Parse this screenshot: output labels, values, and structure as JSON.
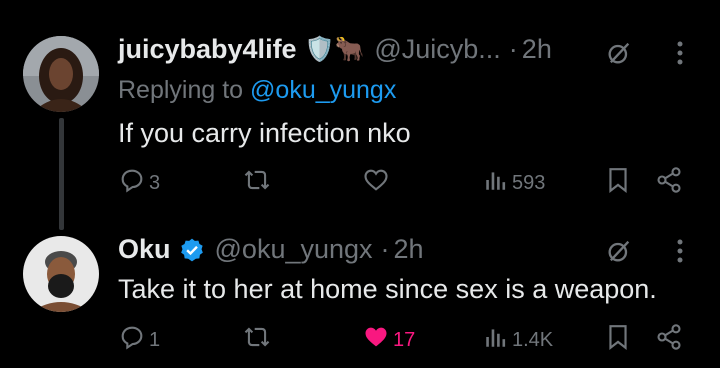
{
  "tweets": [
    {
      "name": "juicybaby4life",
      "badge_emojis": "🛡️🐂",
      "handle": "@Juicyb...",
      "dot": "·",
      "time": "2h",
      "replying_prefix": "Replying to",
      "replying_to": "@oku_yungx",
      "text": "If you carry infection nko",
      "actions": {
        "reply_count": "3",
        "retweet_count": "",
        "like_count": "",
        "views_count": "593"
      }
    },
    {
      "name": "Oku",
      "verified": true,
      "handle": "@oku_yungx",
      "dot": "·",
      "time": "2h",
      "text": "Take it to her at home since  sex is a weapon.",
      "actions": {
        "reply_count": "1",
        "retweet_count": "",
        "like_count": "17",
        "liked": true,
        "views_count": "1.4K"
      }
    }
  ],
  "colors": {
    "background": "#000000",
    "text": "#e7e9ea",
    "muted": "#71767b",
    "link": "#1d9bf0",
    "like": "#f91880",
    "verified": "#1d9bf0"
  },
  "icons": [
    "grok-icon",
    "more-icon",
    "reply-icon",
    "retweet-icon",
    "like-icon",
    "views-icon",
    "bookmark-icon",
    "share-icon",
    "verified-badge-icon"
  ]
}
